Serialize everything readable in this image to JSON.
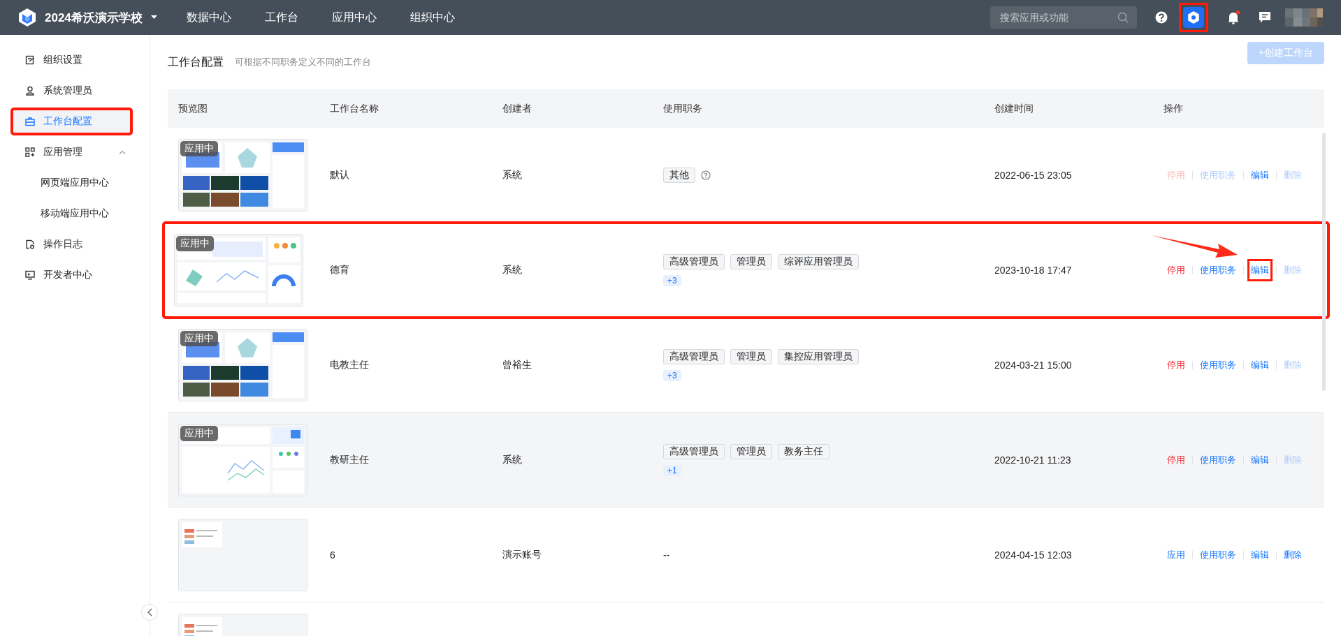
{
  "topbar": {
    "school": "2024希沃演示学校",
    "nav": [
      {
        "label": "数据中心"
      },
      {
        "label": "工作台"
      },
      {
        "label": "应用中心"
      },
      {
        "label": "组织中心"
      }
    ],
    "search": {
      "placeholder": "搜索应用或功能"
    },
    "settings_highlighted": true,
    "notifications_unread": true
  },
  "sidebar": {
    "items": [
      {
        "label": "组织设置",
        "selected": false,
        "highlighted": false
      },
      {
        "label": "系统管理员",
        "selected": false,
        "highlighted": false
      },
      {
        "label": "工作台配置",
        "selected": true,
        "highlighted": true
      },
      {
        "label": "应用管理",
        "selected": false,
        "highlighted": false,
        "expanded": true,
        "children": [
          {
            "label": "网页端应用中心"
          },
          {
            "label": "移动端应用中心"
          }
        ]
      },
      {
        "label": "操作日志",
        "selected": false,
        "highlighted": false
      },
      {
        "label": "开发者中心",
        "selected": false,
        "highlighted": false
      }
    ]
  },
  "page": {
    "title": "工作台配置",
    "subtitle": "可根据不同职务定义不同的工作台",
    "create_button": {
      "label": "+创建工作台",
      "disabled": true
    }
  },
  "table": {
    "columns": [
      "预览图",
      "工作台名称",
      "创建者",
      "使用职务",
      "创建时间",
      "操作"
    ],
    "rows": [
      {
        "preview": {
          "kind": "dashboard-a",
          "badge": "应用中"
        },
        "name": "默认",
        "creator": "系统",
        "roles": [
          "其他"
        ],
        "roles_help": true,
        "time": "2022-06-15 23:05",
        "hovered": false,
        "highlighted": false,
        "actions": [
          {
            "label": "停用",
            "kind": "danger",
            "disabled": true,
            "highlighted": false
          },
          {
            "label": "使用职务",
            "kind": "primary",
            "disabled": true,
            "highlighted": false
          },
          {
            "label": "编辑",
            "kind": "primary",
            "disabled": false,
            "highlighted": false
          },
          {
            "label": "删除",
            "kind": "primary",
            "disabled": true,
            "highlighted": false
          }
        ]
      },
      {
        "preview": {
          "kind": "dashboard-b",
          "badge": "应用中"
        },
        "name": "德育",
        "creator": "系统",
        "roles": [
          "高级管理员",
          "管理员",
          "综评应用管理员"
        ],
        "more_roles": "+3",
        "time": "2023-10-18 17:47",
        "hovered": false,
        "highlighted": true,
        "arrow": true,
        "actions": [
          {
            "label": "停用",
            "kind": "danger",
            "disabled": false,
            "highlighted": false
          },
          {
            "label": "使用职务",
            "kind": "primary",
            "disabled": false,
            "highlighted": false
          },
          {
            "label": "编辑",
            "kind": "primary",
            "disabled": false,
            "highlighted": true
          },
          {
            "label": "删除",
            "kind": "primary",
            "disabled": true,
            "highlighted": false
          }
        ]
      },
      {
        "preview": {
          "kind": "dashboard-a",
          "badge": "应用中"
        },
        "name": "电教主任",
        "creator": "曾裕生",
        "roles": [
          "高级管理员",
          "管理员",
          "集控应用管理员"
        ],
        "more_roles": "+3",
        "time": "2024-03-21 15:00",
        "hovered": false,
        "highlighted": false,
        "actions": [
          {
            "label": "停用",
            "kind": "danger",
            "disabled": false,
            "highlighted": false
          },
          {
            "label": "使用职务",
            "kind": "primary",
            "disabled": false,
            "highlighted": false
          },
          {
            "label": "编辑",
            "kind": "primary",
            "disabled": false,
            "highlighted": false
          },
          {
            "label": "删除",
            "kind": "primary",
            "disabled": true,
            "highlighted": false
          }
        ]
      },
      {
        "preview": {
          "kind": "dashboard-c",
          "badge": "应用中"
        },
        "name": "教研主任",
        "creator": "系统",
        "roles": [
          "高级管理员",
          "管理员",
          "教务主任"
        ],
        "more_roles": "+1",
        "time": "2022-10-21 11:23",
        "hovered": true,
        "highlighted": false,
        "actions": [
          {
            "label": "停用",
            "kind": "danger",
            "disabled": false,
            "highlighted": false
          },
          {
            "label": "使用职务",
            "kind": "primary",
            "disabled": false,
            "highlighted": false
          },
          {
            "label": "编辑",
            "kind": "primary",
            "disabled": false,
            "highlighted": false
          },
          {
            "label": "删除",
            "kind": "primary",
            "disabled": true,
            "highlighted": false
          }
        ]
      },
      {
        "preview": {
          "kind": "list"
        },
        "name": "6",
        "creator": "演示账号",
        "roles_empty": "--",
        "time": "2024-04-15 12:03",
        "highlighted": false,
        "actions": [
          {
            "label": "应用",
            "kind": "primary",
            "disabled": false,
            "highlighted": false
          },
          {
            "label": "使用职务",
            "kind": "primary",
            "disabled": false,
            "highlighted": false
          },
          {
            "label": "编辑",
            "kind": "primary",
            "disabled": false,
            "highlighted": false
          },
          {
            "label": "删除",
            "kind": "primary",
            "disabled": false,
            "highlighted": false
          }
        ]
      },
      {
        "preview": {
          "kind": "list"
        },
        "highlighted": false
      }
    ]
  }
}
